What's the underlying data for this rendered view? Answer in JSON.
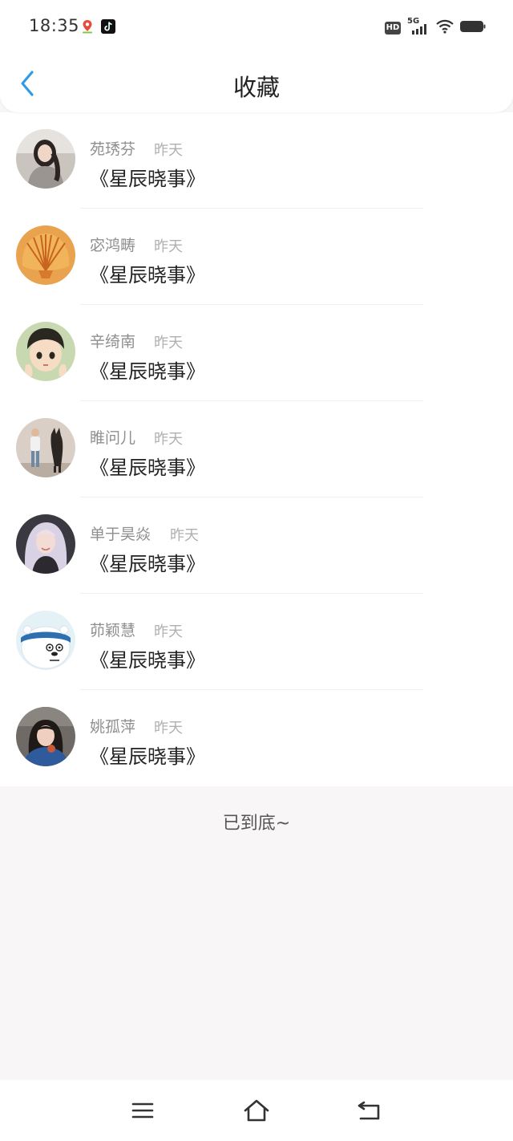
{
  "status_bar": {
    "time": "18:35",
    "network": "5G",
    "hd_badge": "HD",
    "icons": [
      "maps-app-icon",
      "tiktok-app-icon",
      "hd-icon",
      "signal-icon",
      "wifi-icon",
      "battery-icon"
    ]
  },
  "header": {
    "title": "收藏",
    "back_icon": "chevron-left-icon",
    "accent_color": "#2f9be8"
  },
  "favorites": [
    {
      "name": "苑琇芬",
      "time": "昨天",
      "title": "《星辰晓事》",
      "avatar": "avatar-girl-sweater"
    },
    {
      "name": "宓鸿畴",
      "time": "昨天",
      "title": "《星辰晓事》",
      "avatar": "avatar-seashell"
    },
    {
      "name": "辛绮南",
      "time": "昨天",
      "title": "《星辰晓事》",
      "avatar": "avatar-anime-boy"
    },
    {
      "name": "睢问儿",
      "time": "昨天",
      "title": "《星辰晓事》",
      "avatar": "avatar-person-dog"
    },
    {
      "name": "单于昊焱",
      "time": "昨天",
      "title": "《星辰晓事》",
      "avatar": "avatar-silver-hair-girl"
    },
    {
      "name": "茆颖慧",
      "time": "昨天",
      "title": "《星辰晓事》",
      "avatar": "avatar-cartoon-bear"
    },
    {
      "name": "姚孤萍",
      "time": "昨天",
      "title": "《星辰晓事》",
      "avatar": "avatar-girl-dark-hair"
    }
  ],
  "list_end_text": "已到底~",
  "nav_bar": {
    "icons": [
      "menu-icon",
      "home-icon",
      "back-icon"
    ]
  }
}
